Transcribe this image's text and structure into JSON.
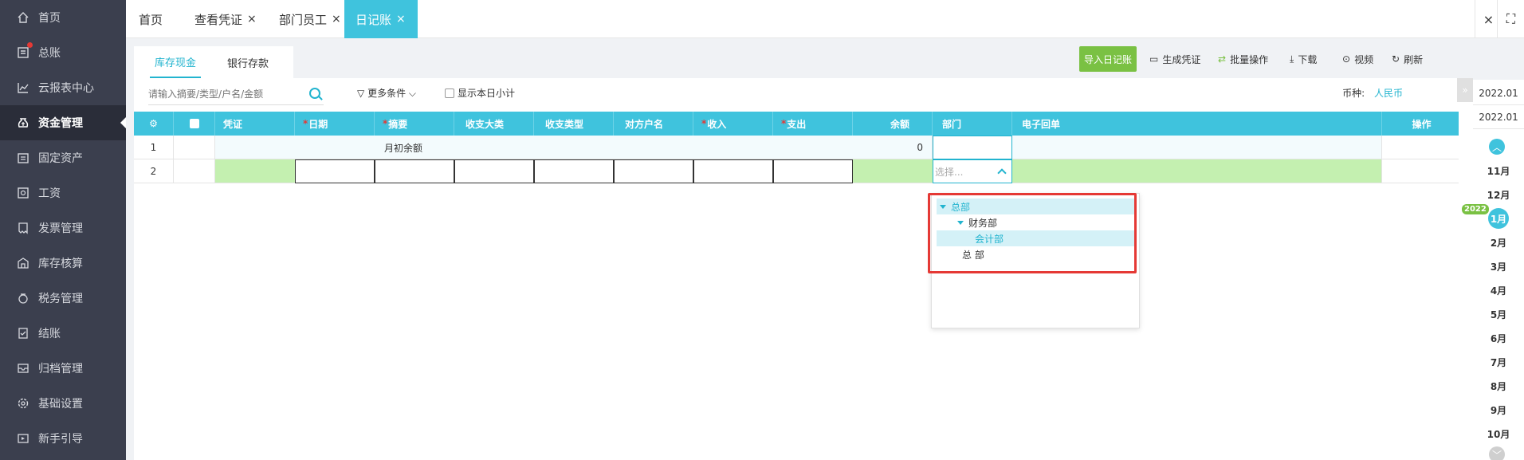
{
  "sidebar": {
    "items": [
      {
        "label": "首页",
        "icon": "home-icon"
      },
      {
        "label": "总账",
        "icon": "ledger-icon"
      },
      {
        "label": "云报表中心",
        "icon": "chart-icon"
      },
      {
        "label": "资金管理",
        "icon": "money-bag-icon"
      },
      {
        "label": "固定资产",
        "icon": "asset-icon"
      },
      {
        "label": "工资",
        "icon": "salary-icon"
      },
      {
        "label": "发票管理",
        "icon": "invoice-icon"
      },
      {
        "label": "库存核算",
        "icon": "warehouse-icon"
      },
      {
        "label": "税务管理",
        "icon": "tax-icon"
      },
      {
        "label": "结账",
        "icon": "checkout-icon"
      },
      {
        "label": "归档管理",
        "icon": "archive-icon"
      },
      {
        "label": "基础设置",
        "icon": "gear-icon"
      },
      {
        "label": "新手引导",
        "icon": "guide-icon"
      }
    ],
    "active": "资金管理"
  },
  "tabs": [
    {
      "label": "首页"
    },
    {
      "label": "查看凭证",
      "close": "×"
    },
    {
      "label": "部门员工",
      "close": "×"
    },
    {
      "label": "日记账",
      "close": "×"
    }
  ],
  "window_controls": {
    "close": "×",
    "fullscreen": "⛶"
  },
  "subtabs": [
    "库存现金",
    "银行存款"
  ],
  "toolbar": {
    "import": "导入日记账",
    "generate": "生成凭证",
    "batch": "批量操作",
    "download": "下载",
    "video": "视频",
    "refresh": "刷新"
  },
  "filter": {
    "search_placeholder": "请输入摘要/类型/户名/金额",
    "more": "更多条件",
    "daily_subtotal": "显示本日小计",
    "currency_label": "币种:",
    "currency_value": "人民币"
  },
  "table": {
    "headers": [
      "凭证",
      "日期",
      "摘要",
      "收支大类",
      "收支类型",
      "对方户名",
      "收入",
      "支出",
      "余额",
      "部门",
      "电子回单",
      "操作"
    ],
    "rows": [
      {
        "no": "1",
        "summary": "月初余额",
        "balance": "0"
      },
      {
        "no": "2",
        "dept_placeholder": "选择..."
      }
    ]
  },
  "dept_tree": [
    {
      "label": "总部",
      "level": 0,
      "expanded": true
    },
    {
      "label": "财务部",
      "level": 1,
      "expanded": true
    },
    {
      "label": "会计部",
      "level": 2
    },
    {
      "label": "总 部",
      "level": 1
    }
  ],
  "calendar": {
    "periods": [
      "2022.01",
      "2022.01"
    ],
    "months": [
      "11月",
      "12月",
      "1月",
      "2月",
      "3月",
      "4月",
      "5月",
      "6月",
      "7月",
      "8月",
      "9月",
      "10月"
    ],
    "active_month": "1月",
    "year_badge": "2022"
  },
  "colors": {
    "accent": "#3fc3dd",
    "green": "#7ac143",
    "sidebar": "#3b3f4e",
    "highlight": "#e53935"
  }
}
